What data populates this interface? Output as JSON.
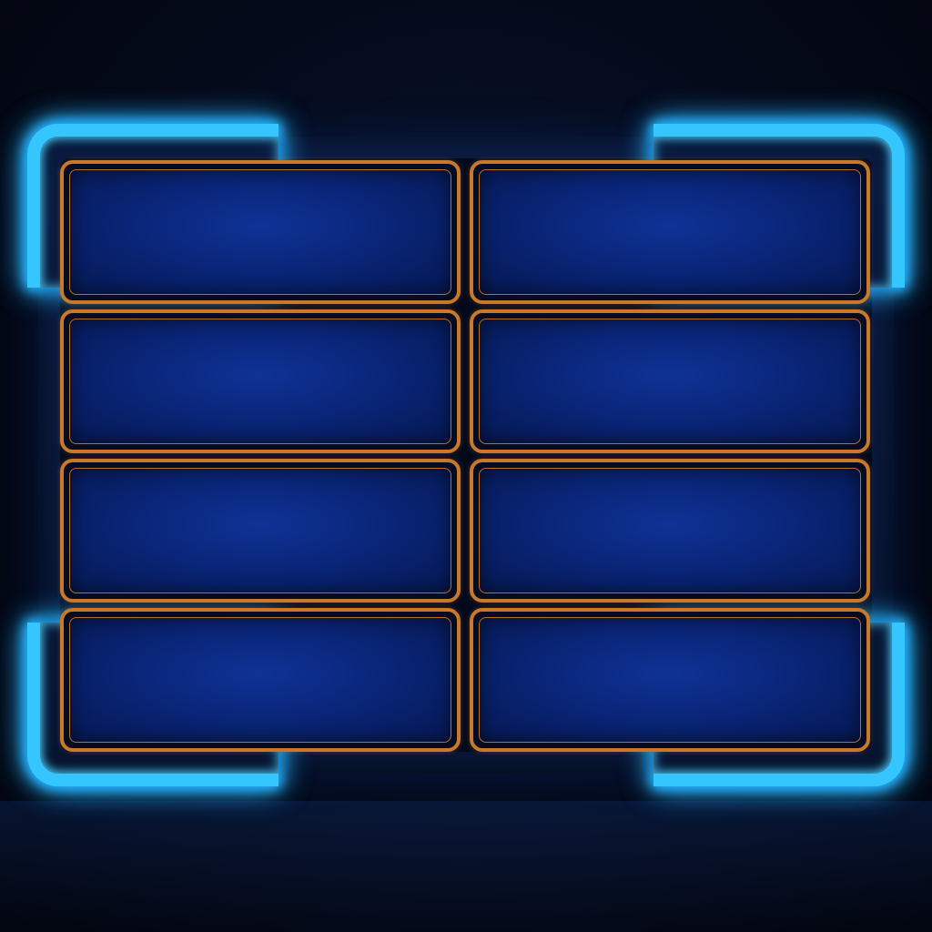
{
  "board": {
    "title": "",
    "accent_color": "#35c6ff",
    "tile_border_color": "#c9782c",
    "tile_fill_color": "#0a267a",
    "tiles": [
      {
        "label": ""
      },
      {
        "label": ""
      },
      {
        "label": ""
      },
      {
        "label": ""
      },
      {
        "label": ""
      },
      {
        "label": ""
      },
      {
        "label": ""
      },
      {
        "label": ""
      }
    ]
  }
}
